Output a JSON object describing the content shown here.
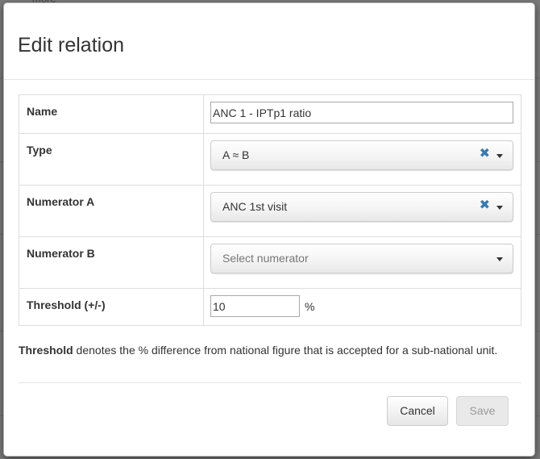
{
  "background": {
    "partial_text": "more"
  },
  "dialog": {
    "title": "Edit relation"
  },
  "form": {
    "name_label": "Name",
    "name_value": "ANC 1 - IPTp1 ratio",
    "type_label": "Type",
    "type_value": "A ≈ B",
    "numerator_a_label": "Numerator A",
    "numerator_a_value": "ANC 1st visit",
    "numerator_b_label": "Numerator B",
    "numerator_b_placeholder": "Select numerator",
    "threshold_label": "Threshold (+/-)",
    "threshold_value": "10",
    "threshold_unit": "%",
    "clear_glyph": "✖"
  },
  "help": {
    "term": "Threshold",
    "text": " denotes the % difference from national figure that is accepted for a sub-national unit."
  },
  "buttons": {
    "cancel_label": "Cancel",
    "save_label": "Save"
  },
  "colors": {
    "clear_icon": "#337ab7",
    "backdrop": "#7a7a7a"
  },
  "icons": {
    "clear": "clear-icon",
    "dropdown": "chevron-down-icon"
  }
}
